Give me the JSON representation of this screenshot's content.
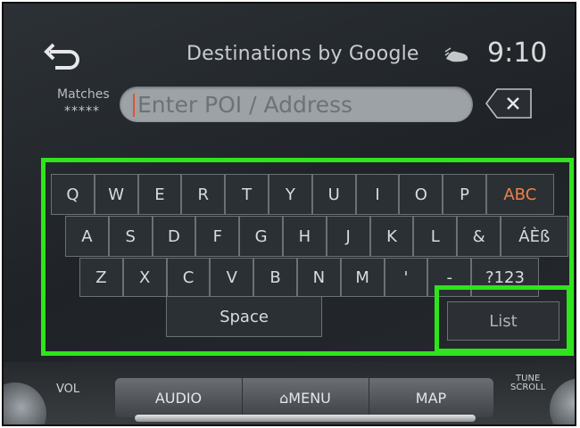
{
  "header": {
    "title": "Destinations by Google",
    "clock": "9:10",
    "back_icon": "back-arrow-icon",
    "status_icon": "phone-status-icon"
  },
  "search": {
    "matches_label": "Matches",
    "matches_count": "*****",
    "placeholder": "Enter POI / Address",
    "clear_icon": "backspace-icon"
  },
  "keyboard": {
    "row1": [
      "Q",
      "W",
      "E",
      "R",
      "T",
      "Y",
      "U",
      "I",
      "O",
      "P",
      "ABC"
    ],
    "row2": [
      "A",
      "S",
      "D",
      "F",
      "G",
      "H",
      "J",
      "K",
      "L",
      "&",
      "ÁÈß"
    ],
    "row3": [
      "Z",
      "X",
      "C",
      "V",
      "B",
      "N",
      "M",
      "'",
      "-",
      "?123"
    ],
    "space": "Space",
    "list": "List"
  },
  "console": {
    "vol": "VOL",
    "tune_line1": "TUNE",
    "tune_line2": "SCROLL",
    "audio": "AUDIO",
    "menu": "⌂MENU",
    "map": "MAP"
  },
  "colors": {
    "highlight": "#2fe41c",
    "abc_accent": "#f08245"
  }
}
